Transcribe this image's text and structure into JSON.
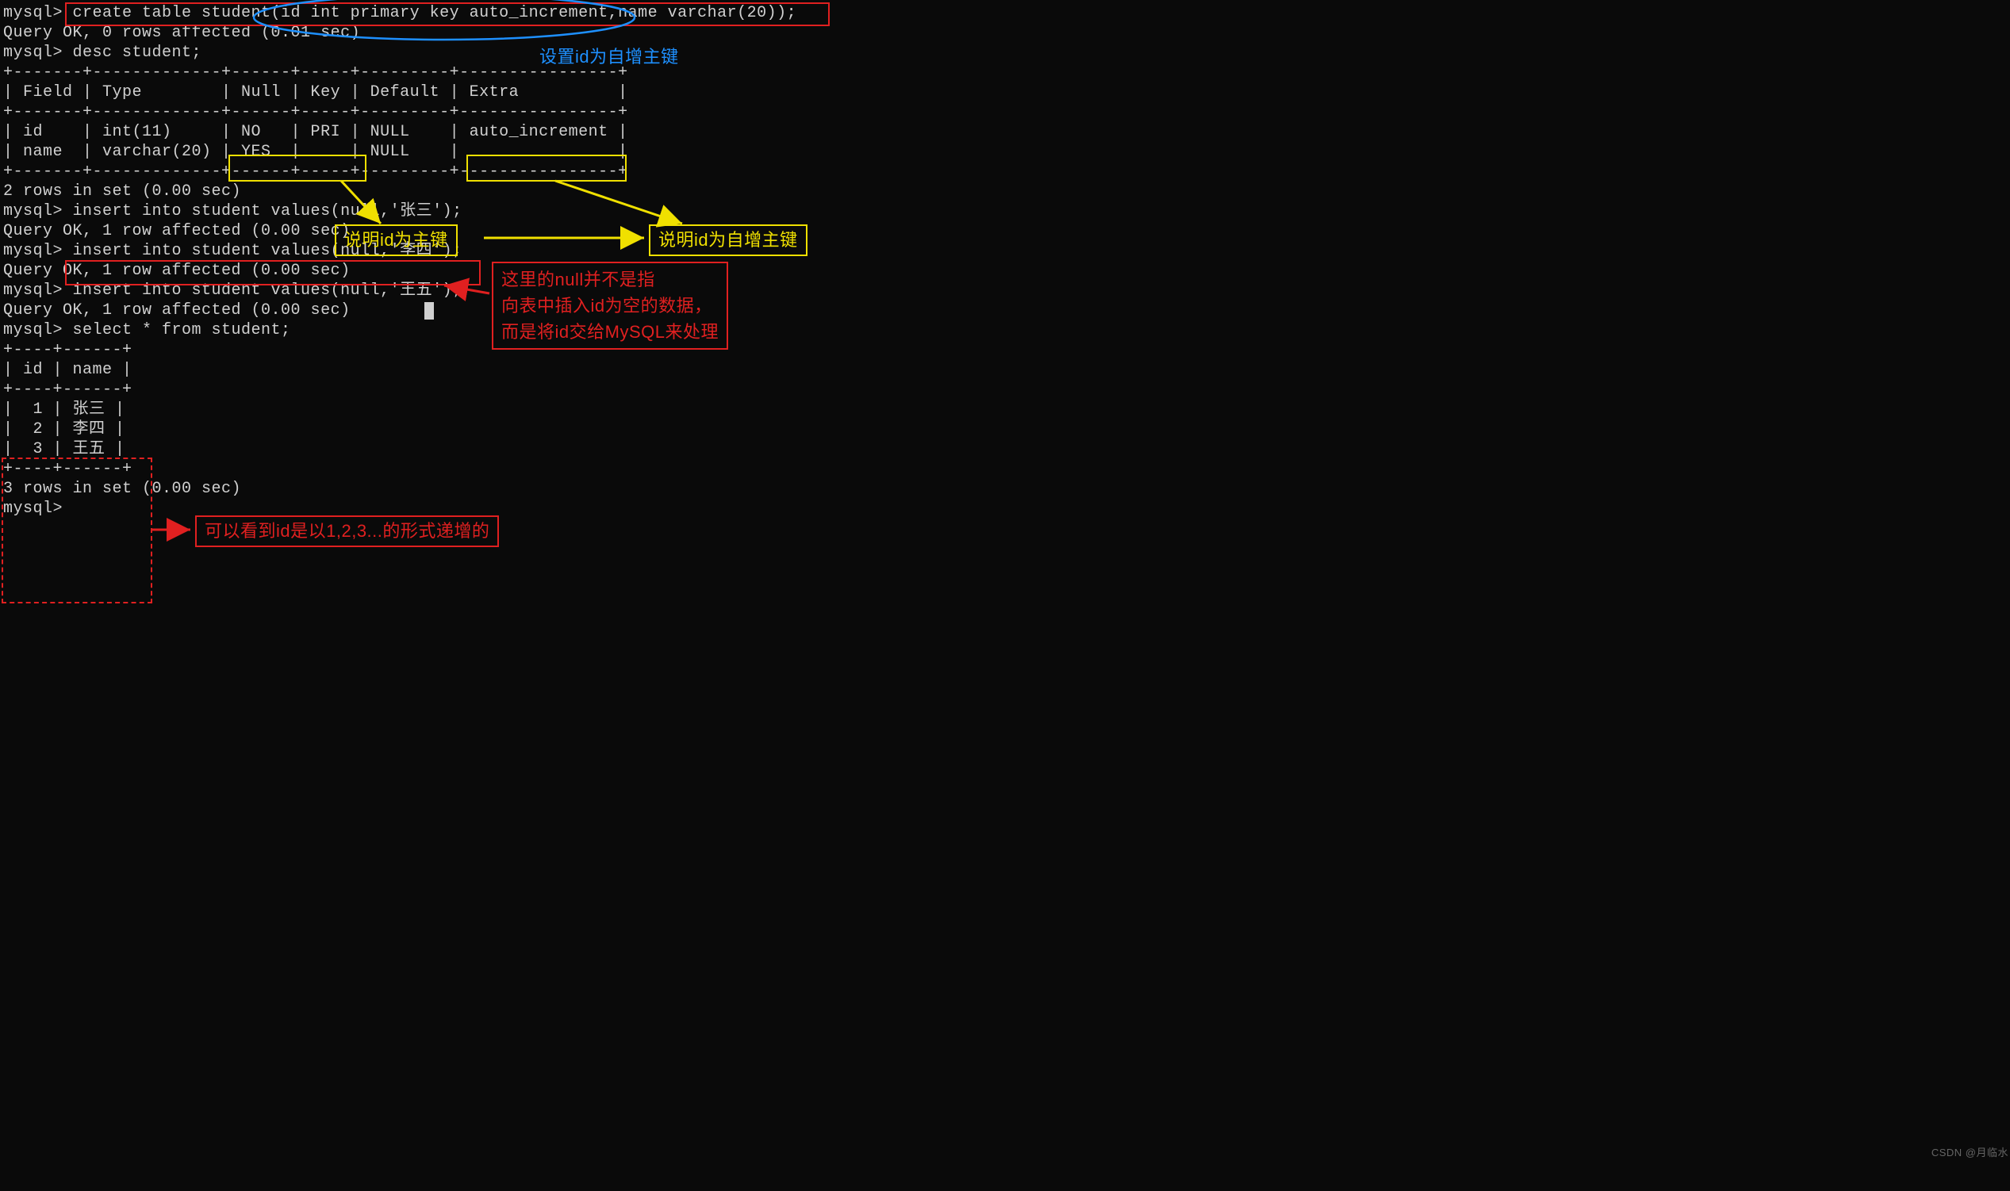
{
  "prompt": "mysql>",
  "lines": {
    "l1": "mysql> create table student(id int primary key auto_increment,name varchar(20));",
    "l2": "Query OK, 0 rows affected (0.01 sec)",
    "l3": "",
    "l4": "mysql> desc student;",
    "l5": "+-------+-------------+------+-----+---------+----------------+",
    "l6": "| Field | Type        | Null | Key | Default | Extra          |",
    "l7": "+-------+-------------+------+-----+---------+----------------+",
    "l8": "| id    | int(11)     | NO   | PRI | NULL    | auto_increment |",
    "l9": "| name  | varchar(20) | YES  |     | NULL    |                |",
    "l10": "+-------+-------------+------+-----+---------+----------------+",
    "l11": "2 rows in set (0.00 sec)",
    "l12": "",
    "l13": "mysql> insert into student values(null,'张三');",
    "l14": "Query OK, 1 row affected (0.00 sec)",
    "l15": "",
    "l16": "mysql> insert into student values(null,'李四');",
    "l17": "Query OK, 1 row affected (0.00 sec)",
    "l18": "",
    "l19": "mysql> insert into student values(null,'王五');",
    "l20": "Query OK, 1 row affected (0.00 sec)",
    "l21": "",
    "l22": "mysql> select * from student;",
    "l23": "+----+------+",
    "l24": "| id | name |",
    "l25": "+----+------+",
    "l26": "|  1 | 张三 |",
    "l27": "|  2 | 李四 |",
    "l28": "|  3 | 王五 |",
    "l29": "+----+------+",
    "l30": "3 rows in set (0.00 sec)",
    "l31": "",
    "l32": "mysql>"
  },
  "desc_table": {
    "headers": [
      "Field",
      "Type",
      "Null",
      "Key",
      "Default",
      "Extra"
    ],
    "rows": [
      {
        "Field": "id",
        "Type": "int(11)",
        "Null": "NO",
        "Key": "PRI",
        "Default": "NULL",
        "Extra": "auto_increment"
      },
      {
        "Field": "name",
        "Type": "varchar(20)",
        "Null": "YES",
        "Key": "",
        "Default": "NULL",
        "Extra": ""
      }
    ]
  },
  "select_table": {
    "headers": [
      "id",
      "name"
    ],
    "rows": [
      {
        "id": 1,
        "name": "张三"
      },
      {
        "id": 2,
        "name": "李四"
      },
      {
        "id": 3,
        "name": "王五"
      }
    ]
  },
  "annotations": {
    "blue1": "设置id为自增主键",
    "yellow1": "说明id为主键",
    "yellow2": "说明id为自增主键",
    "red1a": "这里的null并不是指",
    "red1b": "向表中插入id为空的数据，",
    "red1c": "而是将id交给MySQL来处理",
    "red2": "可以看到id是以1,2,3...的形式递增的"
  },
  "colors": {
    "red": "#e02020",
    "yellow": "#f0e000",
    "blue": "#1e90ff",
    "terminal_fg": "#d0d0d0",
    "terminal_bg": "#0a0a0a"
  },
  "watermark": "CSDN @月临水"
}
